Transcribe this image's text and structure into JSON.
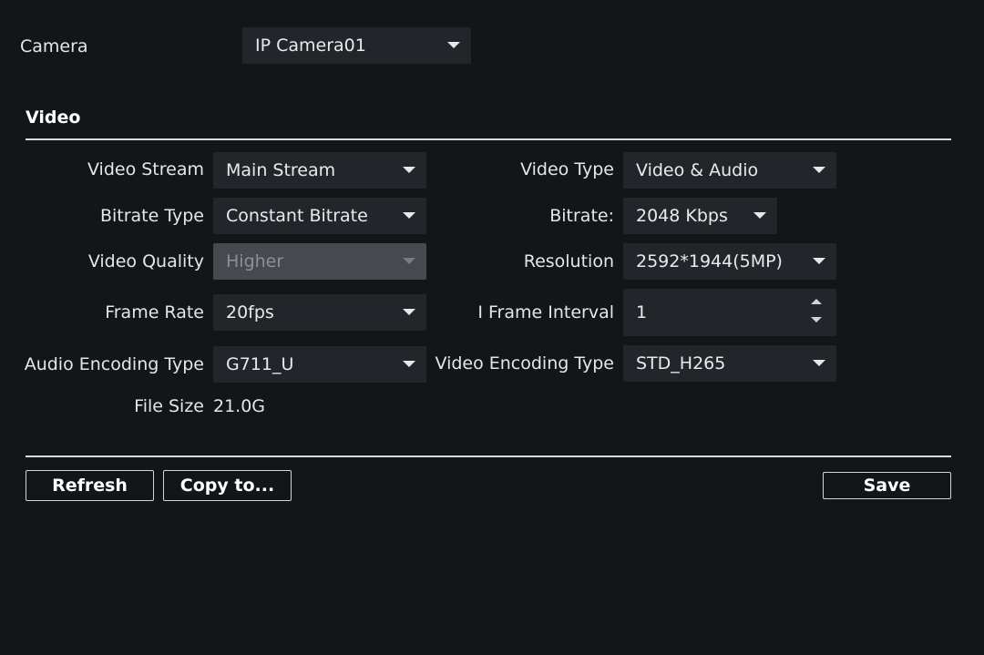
{
  "camera": {
    "label": "Camera",
    "value": "IP Camera01"
  },
  "section": {
    "title": "Video"
  },
  "fields": {
    "video_stream": {
      "label": "Video Stream",
      "value": "Main Stream"
    },
    "video_type": {
      "label": "Video Type",
      "value": "Video & Audio"
    },
    "bitrate_type": {
      "label": "Bitrate Type",
      "value": "Constant Bitrate"
    },
    "bitrate": {
      "label": "Bitrate:",
      "value": "2048 Kbps"
    },
    "video_quality": {
      "label": "Video Quality",
      "value": "Higher"
    },
    "resolution": {
      "label": "Resolution",
      "value": "2592*1944(5MP)"
    },
    "frame_rate": {
      "label": "Frame Rate",
      "value": "20fps"
    },
    "i_frame_interval": {
      "label": "I Frame Interval",
      "value": "1"
    },
    "audio_encoding": {
      "label": "Audio Encoding Type",
      "value": "G711_U"
    },
    "video_encoding": {
      "label": "Video Encoding Type",
      "value": "STD_H265"
    },
    "file_size": {
      "label": "File Size",
      "value": "21.0G"
    }
  },
  "buttons": {
    "refresh": "Refresh",
    "copy_to": "Copy to...",
    "save": "Save"
  },
  "colors": {
    "background": "#131619",
    "control": "#22262b",
    "disabled": "#464a4f",
    "text": "#e6e8ea"
  }
}
